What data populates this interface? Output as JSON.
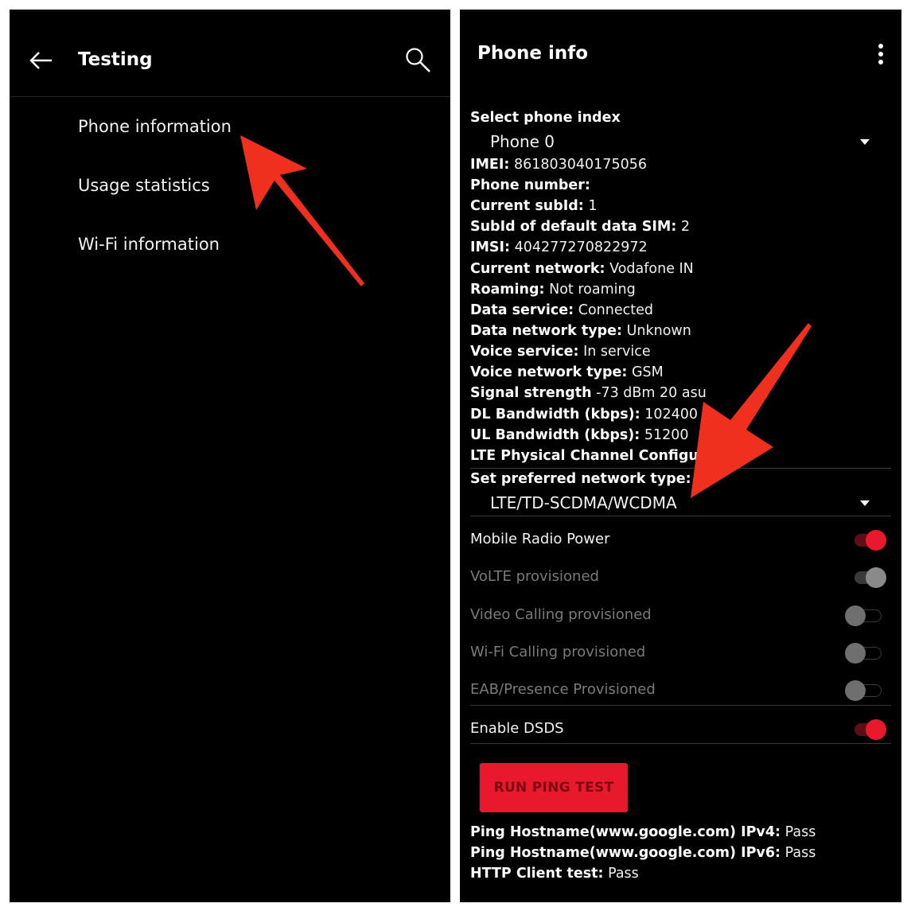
{
  "left": {
    "title": "Testing",
    "items": [
      {
        "label": "Phone information"
      },
      {
        "label": "Usage statistics"
      },
      {
        "label": "Wi-Fi information"
      }
    ]
  },
  "right": {
    "title": "Phone info",
    "select_phone_label": "Select phone index",
    "select_phone_value": "Phone 0",
    "rows": [
      {
        "label": "IMEI:",
        "value": "861803040175056"
      },
      {
        "label": "Phone number:",
        "value": ""
      },
      {
        "label": "Current subId:",
        "value": "1"
      },
      {
        "label": "SubId of default data SIM:",
        "value": "2"
      },
      {
        "label": "IMSI:",
        "value": "404277270822972"
      },
      {
        "label": "Current network:",
        "value": "Vodafone IN"
      },
      {
        "label": "Roaming:",
        "value": "Not roaming"
      },
      {
        "label": "Data service:",
        "value": "Connected"
      },
      {
        "label": "Data network type:",
        "value": "Unknown"
      },
      {
        "label": "Voice service:",
        "value": "In service"
      },
      {
        "label": "Voice network type:",
        "value": "GSM"
      },
      {
        "label": "Signal strength",
        "value": "-73 dBm   20 asu"
      },
      {
        "label": "DL Bandwidth (kbps):",
        "value": "102400"
      },
      {
        "label": "UL Bandwidth (kbps):",
        "value": "51200"
      },
      {
        "label": "LTE Physical Channel Configurati",
        "value": ""
      }
    ],
    "network_type_label": "Set preferred network type:",
    "network_type_value": "LTE/TD-SCDMA/WCDMA",
    "toggles": [
      {
        "label": "Mobile Radio Power",
        "on": true,
        "enabled": true
      },
      {
        "label": "VoLTE provisioned",
        "on": true,
        "enabled": false
      },
      {
        "label": "Video Calling provisioned",
        "on": false,
        "enabled": false
      },
      {
        "label": "Wi-Fi Calling provisioned",
        "on": false,
        "enabled": false
      },
      {
        "label": "EAB/Presence Provisioned",
        "on": false,
        "enabled": false
      },
      {
        "label": "Enable DSDS",
        "on": true,
        "enabled": true
      }
    ],
    "ping_button": "RUN PING TEST",
    "results": [
      {
        "label": "Ping Hostname(www.google.com) IPv4:",
        "value": "Pass"
      },
      {
        "label": "Ping Hostname(www.google.com) IPv6:",
        "value": "Pass"
      },
      {
        "label": "HTTP Client test:",
        "value": "Pass"
      }
    ]
  },
  "colors": {
    "accent": "#e8192c",
    "annotation_arrow": "#f0301e",
    "background": "#000000"
  },
  "icons": {
    "back": "arrow-left-icon",
    "search": "search-icon",
    "more": "more-vert-icon"
  }
}
